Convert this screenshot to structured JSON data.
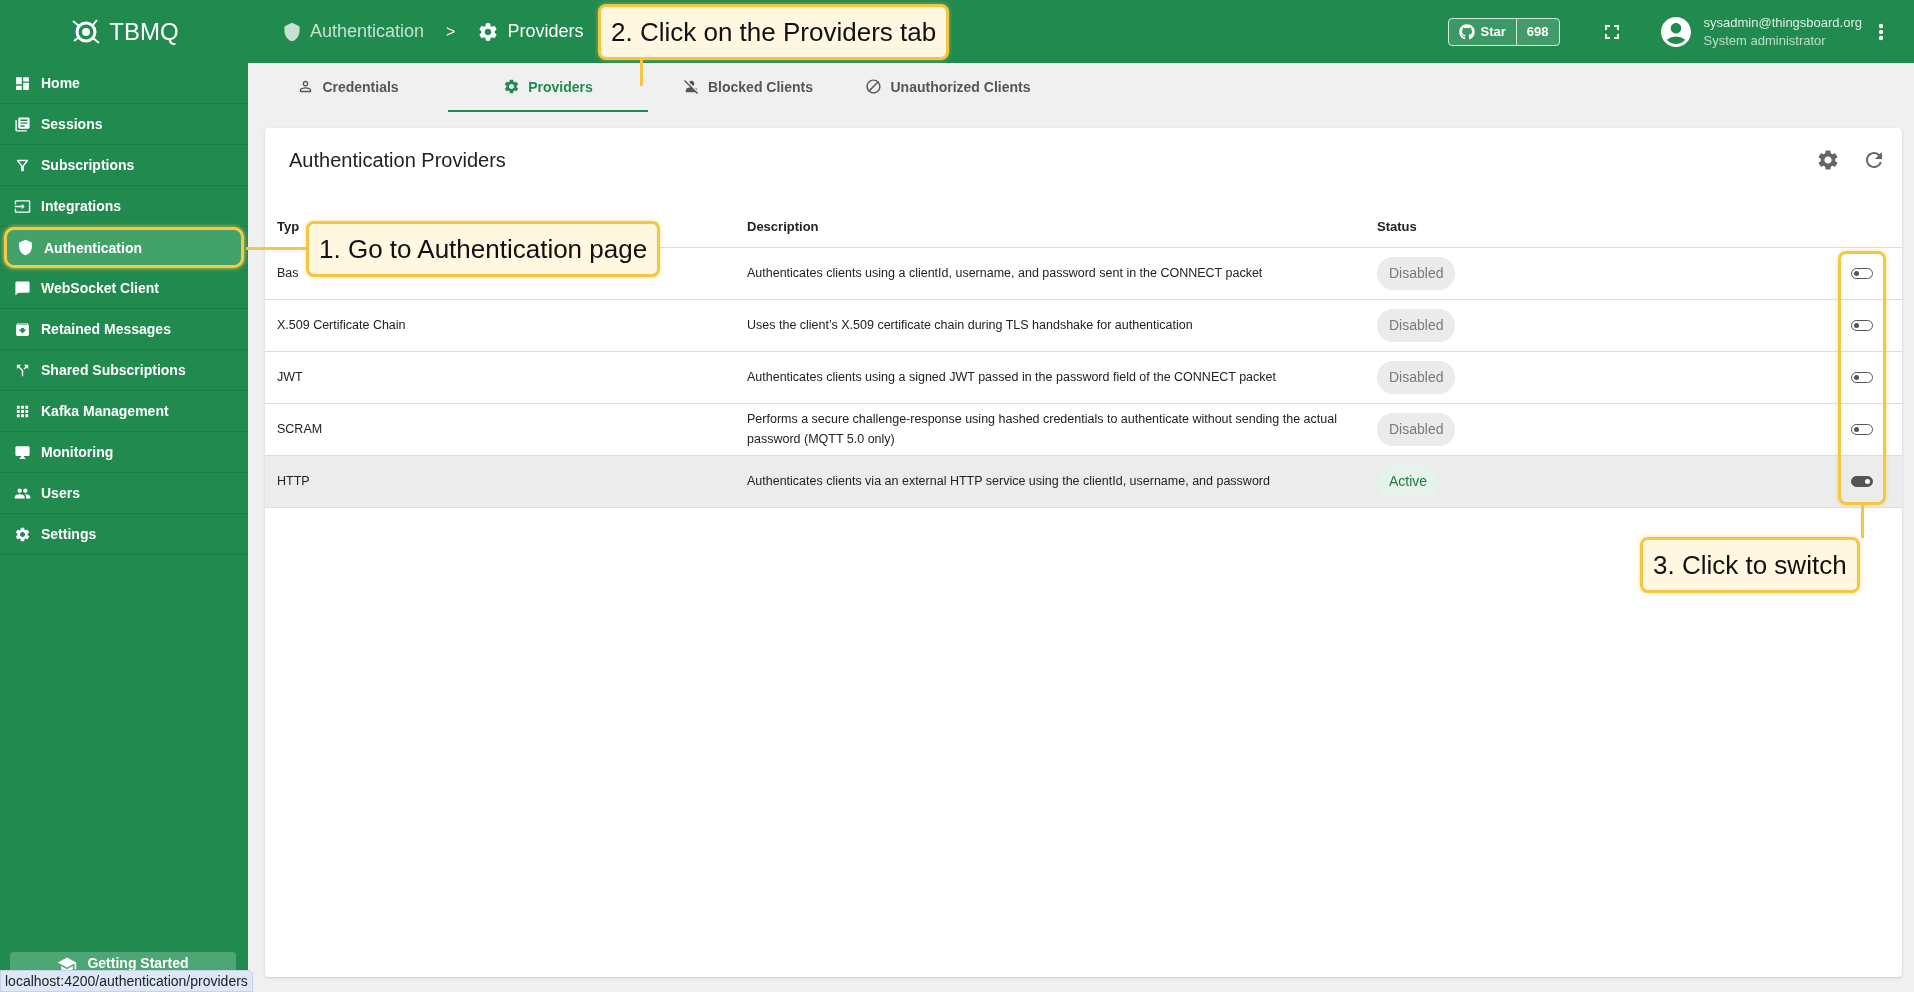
{
  "header": {
    "logo": "TBMQ",
    "breadcrumbs": [
      {
        "label": "Authentication",
        "current": false
      },
      {
        "label": "Providers",
        "current": true
      }
    ],
    "separator": ">",
    "github": {
      "label": "Star",
      "count": "698"
    },
    "user": {
      "email": "sysadmin@thingsboard.org",
      "role": "System administrator"
    }
  },
  "sidebar": {
    "items": [
      {
        "label": "Home",
        "selected": false
      },
      {
        "label": "Sessions",
        "selected": false
      },
      {
        "label": "Subscriptions",
        "selected": false
      },
      {
        "label": "Integrations",
        "selected": false
      },
      {
        "label": "Authentication",
        "selected": true
      },
      {
        "label": "WebSocket Client",
        "selected": false
      },
      {
        "label": "Retained Messages",
        "selected": false
      },
      {
        "label": "Shared Subscriptions",
        "selected": false
      },
      {
        "label": "Kafka Management",
        "selected": false
      },
      {
        "label": "Monitoring",
        "selected": false
      },
      {
        "label": "Users",
        "selected": false
      },
      {
        "label": "Settings",
        "selected": false
      }
    ],
    "getting_started": "Getting Started"
  },
  "tabs": [
    {
      "label": "Credentials",
      "selected": false
    },
    {
      "label": "Providers",
      "selected": true
    },
    {
      "label": "Blocked Clients",
      "selected": false
    },
    {
      "label": "Unauthorized Clients",
      "selected": false
    }
  ],
  "card": {
    "title": "Authentication Providers",
    "columns": [
      "Typ",
      "Description",
      "Status"
    ],
    "rows": [
      {
        "type": "Bas",
        "description": "Authenticates clients using a clientId, username, and password sent in the CONNECT packet",
        "status": "Disabled",
        "active": false,
        "hovered": false
      },
      {
        "type": "X.509 Certificate Chain",
        "description": "Uses the client’s X.509 certificate chain during TLS handshake for authentication",
        "status": "Disabled",
        "active": false,
        "hovered": false
      },
      {
        "type": "JWT",
        "description": "Authenticates clients using a signed JWT passed in the password field of the CONNECT packet",
        "status": "Disabled",
        "active": false,
        "hovered": false
      },
      {
        "type": "SCRAM",
        "description": "Performs a secure challenge-response using hashed credentials to authenticate without sending the actual password (MQTT 5.0 only)",
        "status": "Disabled",
        "active": false,
        "hovered": false
      },
      {
        "type": "HTTP",
        "description": "Authenticates clients via an external HTTP service using the clientId, username, and password",
        "status": "Active",
        "active": true,
        "hovered": true
      }
    ]
  },
  "callouts": [
    "1. Go to Authentication page",
    "2. Click on the Providers tab",
    "3. Click to switch"
  ],
  "status_url": "localhost:4200/authentication/providers"
}
